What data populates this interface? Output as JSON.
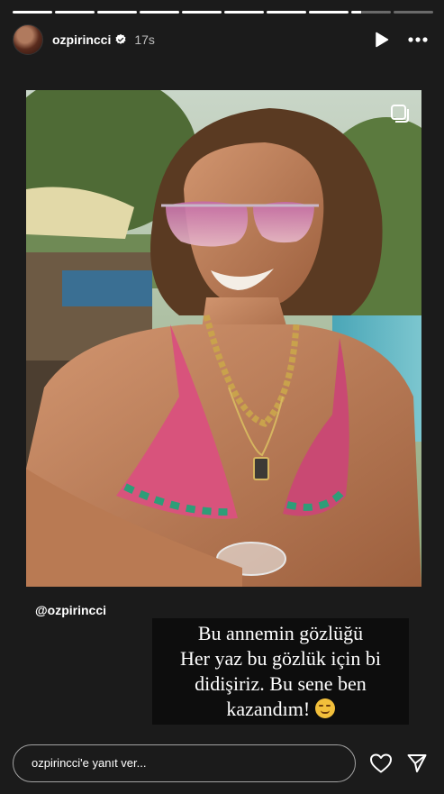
{
  "header": {
    "username": "ozpirincci",
    "time": "17s"
  },
  "progress": {
    "segments_total": 10,
    "segments_done": 8,
    "current_segment_fraction": 0.25
  },
  "story": {
    "mention": "@ozpirincci",
    "caption_lines": [
      "Bu annemin gözlüğü",
      "Her yaz bu gözlük için bi",
      "didişiriz. Bu sene ben",
      "kazandım!"
    ],
    "caption_emoji": "smirking-face-emoji"
  },
  "footer": {
    "reply_placeholder": "ozpirincci'e yanıt ver..."
  },
  "colors": {
    "accent": "#ffffff",
    "background": "#1b1b1b"
  }
}
